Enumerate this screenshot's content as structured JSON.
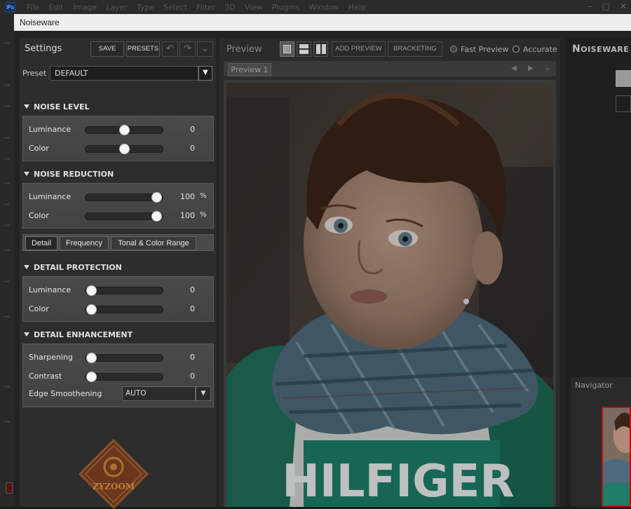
{
  "photoshop": {
    "logo": "Ps",
    "menu": [
      "File",
      "Edit",
      "Image",
      "Layer",
      "Type",
      "Select",
      "Filter",
      "3D",
      "View",
      "Plugins",
      "Window",
      "Help"
    ],
    "window_controls": [
      "–",
      "□",
      "✕"
    ]
  },
  "window": {
    "title": "Noiseware"
  },
  "settings": {
    "title": "Settings",
    "save_label": "SAVE",
    "presets_label": "PRESETS",
    "preset_label": "Preset",
    "preset_value": "DEFAULT",
    "noise_level": {
      "title": "NOISE LEVEL",
      "luminance": {
        "label": "Luminance",
        "value": "0",
        "fraction": 0.5
      },
      "color": {
        "label": "Color",
        "value": "0",
        "fraction": 0.5
      }
    },
    "noise_reduction": {
      "title": "NOISE REDUCTION",
      "luminance": {
        "label": "Luminance",
        "value": "100",
        "unit": "%",
        "fraction": 1.0
      },
      "color": {
        "label": "Color",
        "value": "100",
        "unit": "%",
        "fraction": 1.0
      }
    },
    "tabs": [
      "Detail",
      "Frequency",
      "Tonal & Color Range"
    ],
    "detail_protection": {
      "title": "DETAIL PROTECTION",
      "luminance": {
        "label": "Luminance",
        "value": "0",
        "fraction": 0.0
      },
      "color": {
        "label": "Color",
        "value": "0",
        "fraction": 0.0
      }
    },
    "detail_enhancement": {
      "title": "DETAIL ENHANCEMENT",
      "sharpening": {
        "label": "Sharpening",
        "value": "0",
        "fraction": 0.0
      },
      "contrast": {
        "label": "Contrast",
        "value": "0",
        "fraction": 0.0
      },
      "edge_label": "Edge Smoothening",
      "edge_value": "AUTO"
    },
    "logo_text": "ZYZOOM"
  },
  "preview": {
    "title": "Preview",
    "add_preview_label": "ADD PREVIEW",
    "bracketing_label": "BRACKETING",
    "fast_preview_label": "Fast Preview",
    "accurate_label": "Accurate",
    "selected_mode": "Accurate",
    "tab_label": "Preview 1",
    "shirt_text": "HILFIGER"
  },
  "right_panel": {
    "brand_big": "N",
    "brand_rest": "OISEWARE",
    "navigator_title": "Navigator"
  }
}
